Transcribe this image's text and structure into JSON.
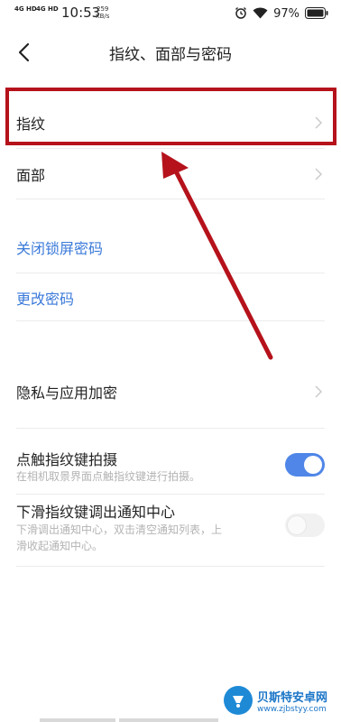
{
  "status_bar": {
    "sim1": "4G HD",
    "sim2": "4G HD",
    "time": "10:53",
    "speed_value": "259",
    "speed_unit": "KB/s",
    "battery_percent": "97%",
    "icons": [
      "alarm-icon",
      "wifi-icon",
      "battery-icon"
    ]
  },
  "header": {
    "title": "指纹、面部与密码",
    "back_icon": "back-arrow-icon"
  },
  "items": {
    "fingerprint": {
      "label": "指纹"
    },
    "face": {
      "label": "面部"
    },
    "close_lock_password": {
      "label": "关闭锁屏密码"
    },
    "change_password": {
      "label": "更改密码"
    },
    "privacy_encryption": {
      "label": "隐私与应用加密"
    },
    "touch_capture": {
      "label": "点触指纹键拍摄",
      "description": "在相机取景界面点触指纹键进行拍摄。",
      "enabled": true
    },
    "swipe_notification": {
      "label": "下滑指纹键调出通知中心",
      "description_line1": "下滑调出通知中心，双击清空通知列表，上",
      "description_line2": "滑收起通知中心。",
      "enabled": false
    }
  },
  "watermark": {
    "title": "贝斯特安卓网",
    "url": "www.zjbstyy.com"
  },
  "colors": {
    "link_blue": "#3b7ad9",
    "toggle_on": "#4f86e8",
    "highlight_red": "#b5121b"
  }
}
